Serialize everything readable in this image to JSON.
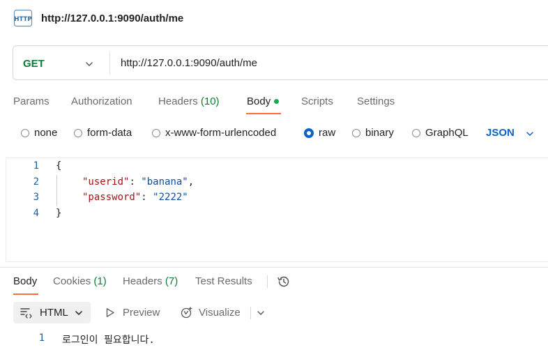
{
  "request": {
    "title": "http://127.0.0.1:9090/auth/me",
    "method": "GET",
    "url": "http://127.0.0.1:9090/auth/me"
  },
  "request_tabs": {
    "params": "Params",
    "authorization": "Authorization",
    "headers": "Headers",
    "headers_count": "(10)",
    "body": "Body",
    "scripts": "Scripts",
    "settings": "Settings",
    "active": "Body"
  },
  "body_types": {
    "none": "none",
    "form_data": "form-data",
    "urlencoded": "x-www-form-urlencoded",
    "raw": "raw",
    "binary": "binary",
    "graphql": "GraphQL",
    "selected": "raw",
    "language": "JSON"
  },
  "editor": {
    "line_numbers": [
      "1",
      "2",
      "3",
      "4"
    ],
    "open_brace": "{",
    "close_brace": "}",
    "fields": [
      {
        "key": "\"userid\"",
        "value": "\"banana\"",
        "trail": ","
      },
      {
        "key": "\"password\"",
        "value": "\"2222\"",
        "trail": ""
      }
    ]
  },
  "response_tabs": {
    "body": "Body",
    "cookies": "Cookies",
    "cookies_count": "(1)",
    "headers": "Headers",
    "headers_count": "(7)",
    "test_results": "Test Results",
    "active": "Body"
  },
  "response_toolbar": {
    "format": "HTML",
    "preview": "Preview",
    "visualize": "Visualize"
  },
  "response_body": {
    "line_number": "1",
    "text": "로그인이 필요합니다."
  },
  "icons": {
    "request_type": "http-icon",
    "method_dropdown": "chevron-down-icon",
    "language_dropdown": "chevron-down-icon",
    "history": "history-icon",
    "format": "code-format-icon",
    "preview": "play-icon",
    "visualize": "visualize-icon"
  },
  "colors": {
    "method_get": "#0a7d32",
    "accent_underline": "#ff6c37",
    "link_blue": "#0b63c4",
    "json_key": "#a31515",
    "json_string": "#0b4fa0",
    "count_green": "#0a7d32"
  }
}
